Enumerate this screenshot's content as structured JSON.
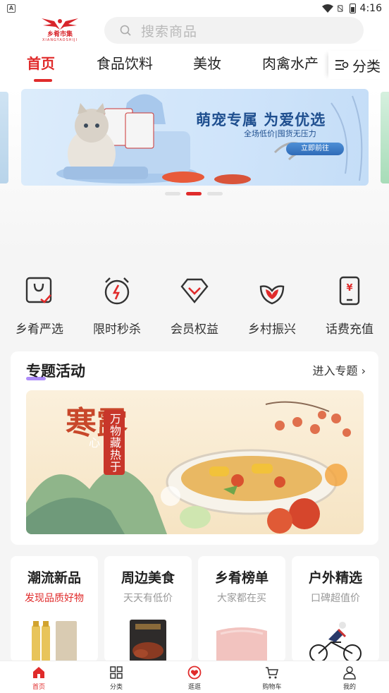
{
  "status_bar": {
    "time": "4:16"
  },
  "header": {
    "logo_text": "乡肴市集",
    "logo_sub": "XIANGYAOSHIJI",
    "search_placeholder": "搜索商品",
    "tabs": [
      "首页",
      "食品饮料",
      "美妆",
      "肉禽水产"
    ],
    "active_tab": "首页",
    "category_label": "分类"
  },
  "banner": {
    "title": "萌宠专属 为爱优选",
    "subtitle": "全场低价|囤货无压力",
    "cta": "立即前往",
    "active_dot": 1,
    "dot_count": 3
  },
  "quick_links": [
    {
      "label": "乡肴严选",
      "icon": "bag-check-icon"
    },
    {
      "label": "限时秒杀",
      "icon": "alarm-clock-icon"
    },
    {
      "label": "会员权益",
      "icon": "diamond-icon"
    },
    {
      "label": "乡村振兴",
      "icon": "leaf-icon"
    },
    {
      "label": "话费充值",
      "icon": "phone-yen-icon"
    }
  ],
  "topic": {
    "title": "专题活动",
    "more": "进入专题",
    "poster_title": "寒露",
    "poster_seal": "万物藏热于心"
  },
  "cards": [
    {
      "title": "潮流新品",
      "subtitle": "发现品质好物",
      "highlight": true
    },
    {
      "title": "周边美食",
      "subtitle": "天天有低价",
      "highlight": false
    },
    {
      "title": "乡肴榜单",
      "subtitle": "大家都在买",
      "highlight": false
    },
    {
      "title": "户外精选",
      "subtitle": "口碑超值价",
      "highlight": false
    }
  ],
  "bottom_nav": [
    {
      "label": "首页",
      "icon": "home-icon",
      "active": true
    },
    {
      "label": "分类",
      "icon": "grid-icon",
      "active": false
    },
    {
      "label": "逛逛",
      "icon": "heart-circle-icon",
      "active": false
    },
    {
      "label": "购物车",
      "icon": "cart-icon",
      "active": false
    },
    {
      "label": "我的",
      "icon": "user-icon",
      "active": false
    }
  ],
  "colors": {
    "accent": "#e02b2b",
    "banner_text": "#1f4f8f"
  }
}
